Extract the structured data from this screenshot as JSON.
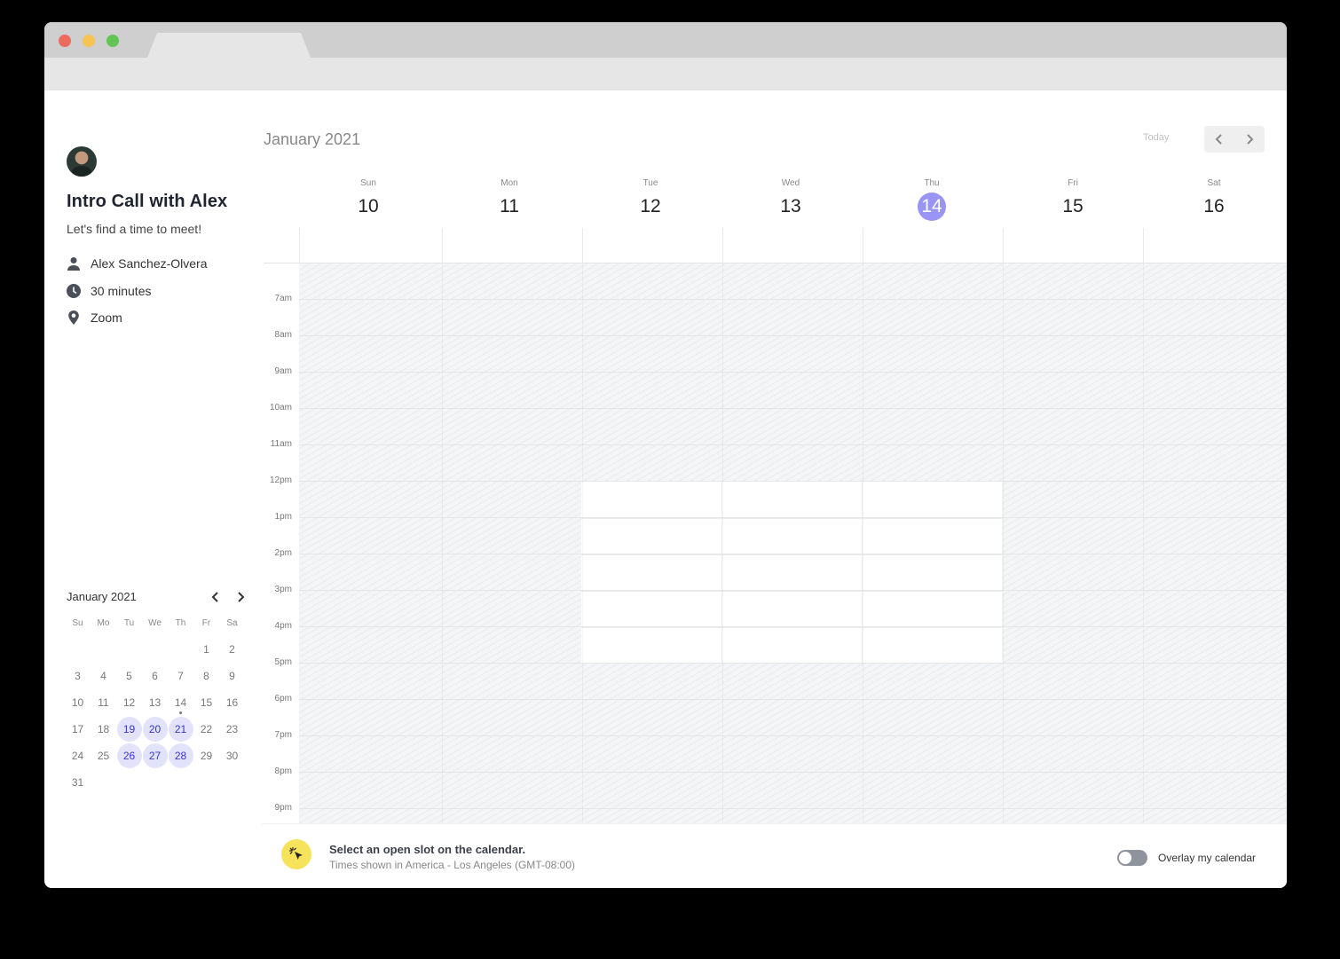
{
  "sidebar": {
    "title": "Intro Call with Alex",
    "subtitle": "Let's find a time to meet!",
    "host": "Alex Sanchez-Olvera",
    "duration": "30 minutes",
    "location": "Zoom",
    "mini_calendar": {
      "month": "January 2021",
      "weekdays": [
        "Su",
        "Mo",
        "Tu",
        "We",
        "Th",
        "Fr",
        "Sa"
      ],
      "weeks": [
        [
          "",
          "",
          "",
          "",
          "",
          "1",
          "2"
        ],
        [
          "3",
          "4",
          "5",
          "6",
          "7",
          "8",
          "9"
        ],
        [
          "10",
          "11",
          "12",
          "13",
          "14",
          "15",
          "16"
        ],
        [
          "17",
          "18",
          "19",
          "20",
          "21",
          "22",
          "23"
        ],
        [
          "24",
          "25",
          "26",
          "27",
          "28",
          "29",
          "30"
        ],
        [
          "31",
          "",
          "",
          "",
          "",
          "",
          ""
        ]
      ],
      "available": [
        "19",
        "20",
        "21",
        "26",
        "27",
        "28"
      ],
      "today": "14"
    }
  },
  "calendar": {
    "month": "January 2021",
    "today_label": "Today",
    "days": [
      {
        "name": "Sun",
        "date": "10"
      },
      {
        "name": "Mon",
        "date": "11"
      },
      {
        "name": "Tue",
        "date": "12"
      },
      {
        "name": "Wed",
        "date": "13"
      },
      {
        "name": "Thu",
        "date": "14",
        "today": true
      },
      {
        "name": "Fri",
        "date": "15"
      },
      {
        "name": "Sat",
        "date": "16"
      }
    ],
    "hours": [
      "7am",
      "8am",
      "9am",
      "10am",
      "11am",
      "12pm",
      "1pm",
      "2pm",
      "3pm",
      "4pm",
      "5pm",
      "6pm",
      "7pm",
      "8pm",
      "9pm"
    ],
    "open_slots": {
      "days": [
        "Tue",
        "Wed",
        "Thu"
      ],
      "from": "12pm",
      "to": "5pm"
    }
  },
  "footer": {
    "main": "Select an open slot on the calendar.",
    "timezone": "Times shown in America - Los Angeles (GMT-08:00)",
    "overlay_label": "Overlay my calendar",
    "overlay_on": false
  },
  "colors": {
    "accent": "#9a95f4",
    "available_bg": "#e2e3fb",
    "available_text": "#3a35c9",
    "pointer_badge": "#f7e35b"
  }
}
